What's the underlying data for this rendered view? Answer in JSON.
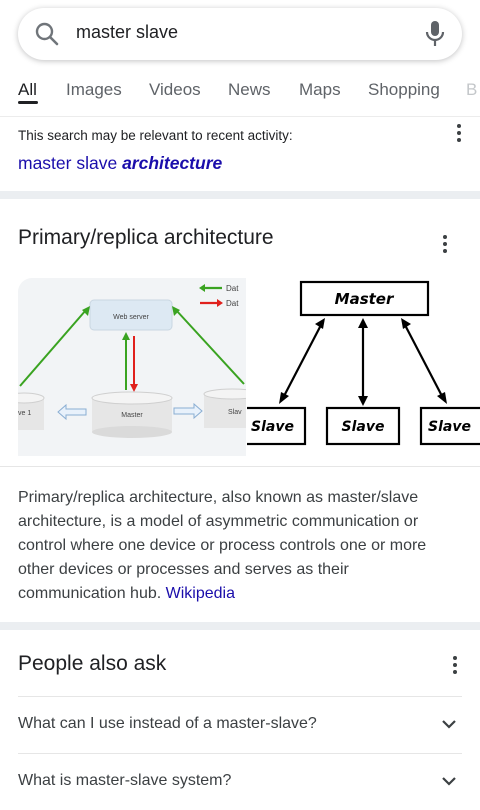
{
  "search": {
    "query": "master slave"
  },
  "tabs": [
    "All",
    "Images",
    "Videos",
    "News",
    "Maps",
    "Shopping",
    "B"
  ],
  "recent": {
    "hint": "This search may be relevant to recent activity:",
    "link_plain": "master slave ",
    "link_bold": "architecture"
  },
  "knowledge_panel": {
    "title": "Primary/replica architecture",
    "image_left": {
      "web_server": "Web server",
      "master": "Master",
      "legend_1": "Dat",
      "legend_2": "Dat",
      "left_cut": "ve 1",
      "right_cut": "Slav"
    },
    "image_right": {
      "master": "Master",
      "slave_1": "Slave",
      "slave_2": "Slave",
      "slave_3": "Slave"
    },
    "description": "Primary/replica architecture, also known as master/slave architecture, is a model of asymmetric communication or control where one device or process controls one or more other devices or processes and serves as their communication hub. ",
    "source": "Wikipedia"
  },
  "people_also_ask": {
    "title": "People also ask",
    "questions": [
      "What can I use instead of a master-slave?",
      "What is master-slave system?"
    ]
  },
  "colors": {
    "link": "#1a0dab",
    "arrow_green": "#3aa321",
    "arrow_red": "#e0201c"
  }
}
